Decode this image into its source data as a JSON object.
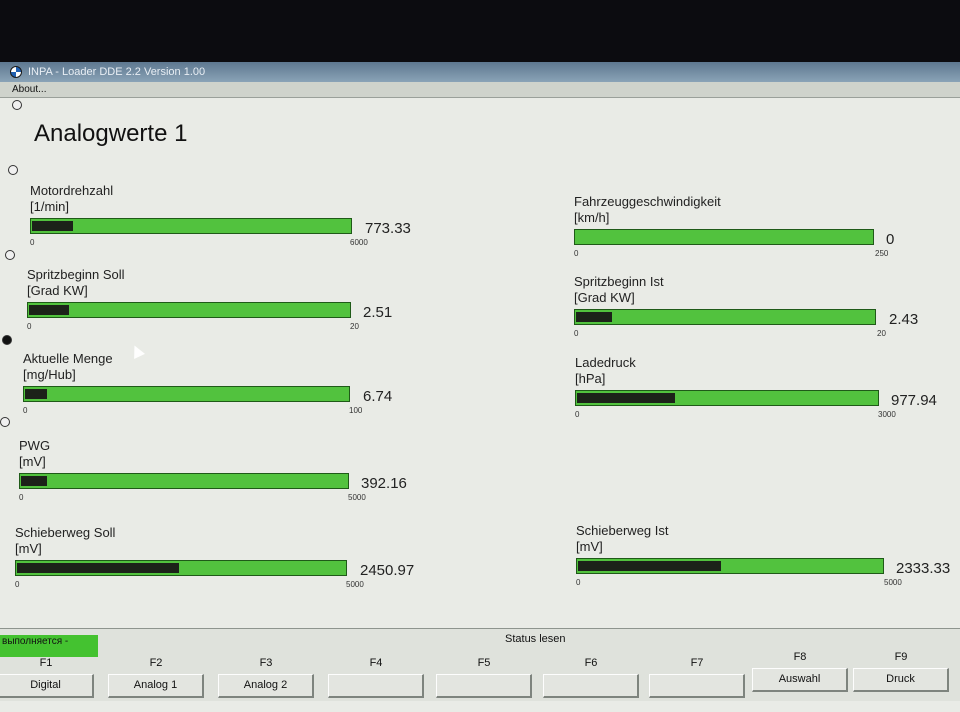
{
  "window": {
    "title": "INPA - Loader  DDE 2.2 Version 1.00",
    "menu": [
      "About..."
    ]
  },
  "screen": {
    "title": "Analogwerte 1"
  },
  "measurements": [
    {
      "id": "motordrehzahl",
      "label": "Motordrehzahl",
      "unit": "[1/min]",
      "value": "773.33",
      "min": "0",
      "max": "6000",
      "fraction": 0.129
    },
    {
      "id": "fahrzeuggeschwindigkeit",
      "label": "Fahrzeuggeschwindigkeit",
      "unit": "[km/h]",
      "value": "0",
      "min": "0",
      "max": "250",
      "fraction": 0.0
    },
    {
      "id": "spritzbeginn-soll",
      "label": "Spritzbeginn Soll",
      "unit": "[Grad KW]",
      "value": "2.51",
      "min": "0",
      "max": "20",
      "fraction": 0.1255
    },
    {
      "id": "spritzbeginn-ist",
      "label": "Spritzbeginn Ist",
      "unit": "[Grad KW]",
      "value": "2.43",
      "min": "0",
      "max": "20",
      "fraction": 0.1215
    },
    {
      "id": "aktuelle-menge",
      "label": "Aktuelle Menge",
      "unit": "[mg/Hub]",
      "value": "6.74",
      "min": "0",
      "max": "100",
      "fraction": 0.0674
    },
    {
      "id": "ladedruck",
      "label": "Ladedruck",
      "unit": "[hPa]",
      "value": "977.94",
      "min": "0",
      "max": "3000",
      "fraction": 0.326
    },
    {
      "id": "pwg",
      "label": "PWG",
      "unit": "[mV]",
      "value": "392.16",
      "min": "0",
      "max": "5000",
      "fraction": 0.0784
    },
    {
      "id": "schieberweg-soll",
      "label": "Schieberweg Soll",
      "unit": "[mV]",
      "value": "2450.97",
      "min": "0",
      "max": "5000",
      "fraction": 0.49
    },
    {
      "id": "schieberweg-ist",
      "label": "Schieberweg Ist",
      "unit": "[mV]",
      "value": "2333.33",
      "min": "0",
      "max": "5000",
      "fraction": 0.4667
    }
  ],
  "status": {
    "running_text": "выполняется -",
    "label": "Status lesen"
  },
  "function_keys": [
    {
      "key": "F1",
      "label": "Digital"
    },
    {
      "key": "F2",
      "label": "Analog 1"
    },
    {
      "key": "F3",
      "label": "Analog 2"
    },
    {
      "key": "F4",
      "label": ""
    },
    {
      "key": "F5",
      "label": ""
    },
    {
      "key": "F6",
      "label": ""
    },
    {
      "key": "F7",
      "label": ""
    },
    {
      "key": "F8",
      "label": "Auswahl"
    },
    {
      "key": "F9",
      "label": "Druck"
    }
  ],
  "colors": {
    "bar_fill": "#52c23e",
    "bar_level": "#1c2219",
    "status_badge": "#44c230"
  }
}
